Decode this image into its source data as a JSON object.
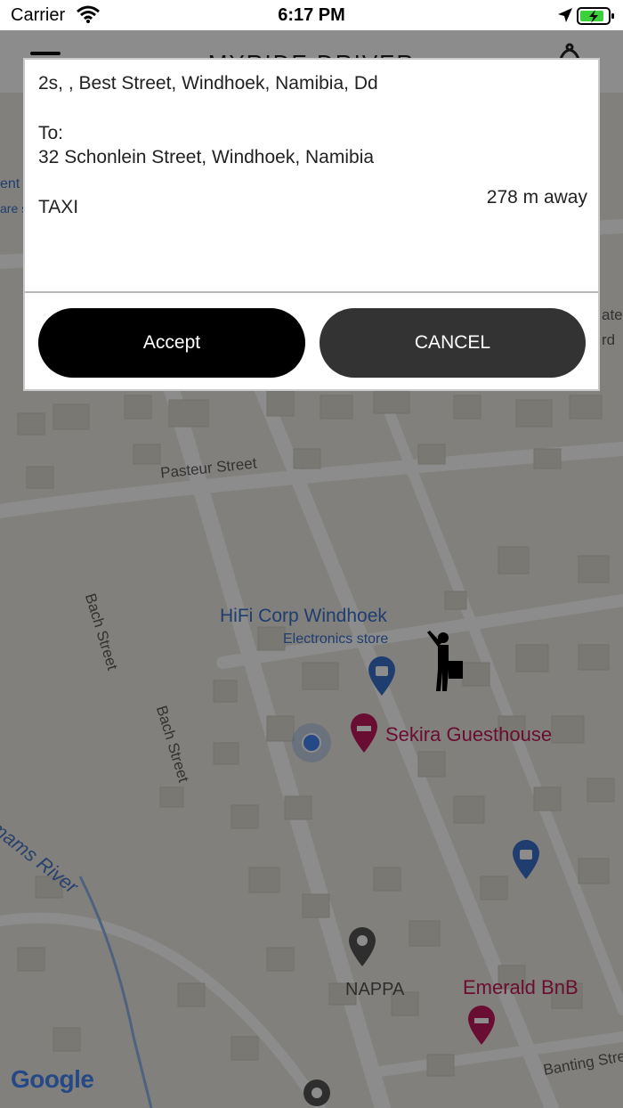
{
  "status_bar": {
    "carrier": "Carrier",
    "time": "6:17 PM"
  },
  "app_bar": {
    "title": "MYRIDE DRIVER"
  },
  "ride_request": {
    "pickup": "2s, , Best Street, Windhoek, Namibia,  Dd",
    "to_label": "To:",
    "destination": "32 Schonlein Street, Windhoek, Namibia",
    "distance": "278 m away",
    "ride_type": "TAXI",
    "accept_label": "Accept",
    "cancel_label": "CANCEL"
  },
  "map": {
    "streets": [
      "Pasteur Street",
      "Bach Street",
      "Bach Street",
      "Banting Stre"
    ],
    "river": "mams River",
    "pois": {
      "hifi_name": "HiFi Corp Windhoek",
      "hifi_type": "Electronics store",
      "sekira": "Sekira Guesthouse",
      "nappa": "NAPPA",
      "emerald": "Emerald BnB"
    },
    "partial_left": [
      "ent",
      "are s"
    ],
    "partial_right": [
      "ate",
      "rd"
    ],
    "google": "Google"
  },
  "colors": {
    "accept_bg": "#000000",
    "cancel_bg": "#333333",
    "poi_red": "#c2185b",
    "poi_blue": "#3a6fc8"
  }
}
